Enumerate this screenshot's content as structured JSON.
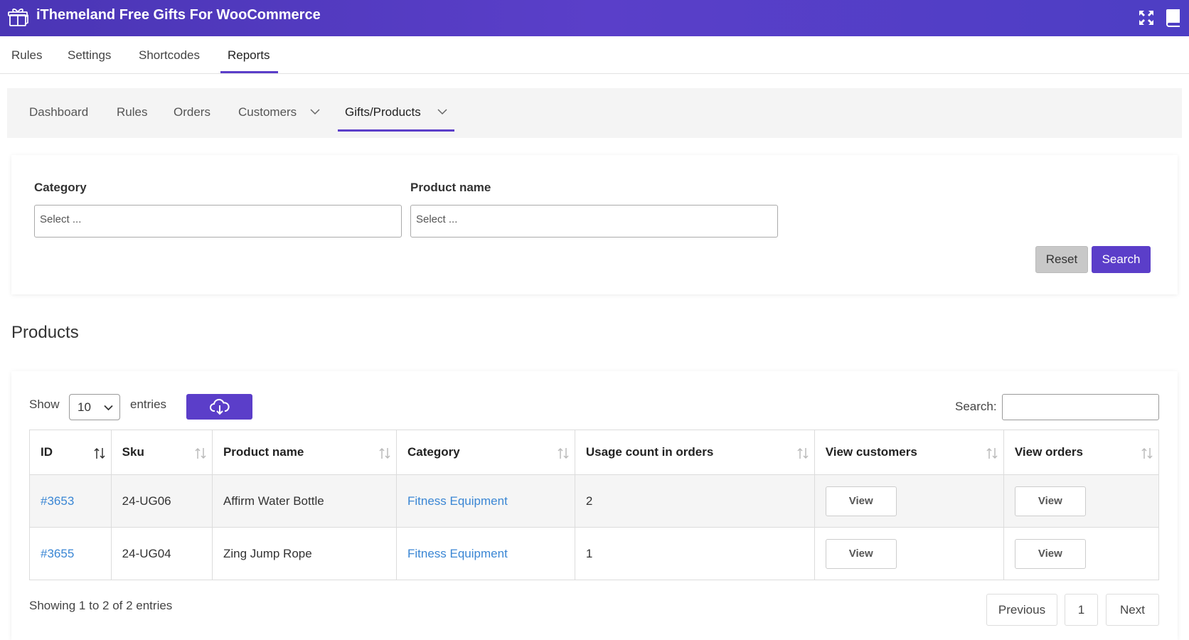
{
  "app": {
    "title": "iThemeland Free Gifts For WooCommerce"
  },
  "main_tabs": [
    "Rules",
    "Settings",
    "Shortcodes",
    "Reports"
  ],
  "sub_tabs": [
    "Dashboard",
    "Rules",
    "Orders",
    "Customers",
    "Gifts/Products"
  ],
  "filters": {
    "category_label": "Category",
    "category_placeholder": "Select ...",
    "product_label": "Product name",
    "product_placeholder": "Select ...",
    "reset_label": "Reset",
    "search_label": "Search"
  },
  "section_title": "Products",
  "table_controls": {
    "show_label": "Show",
    "entries_value": "10",
    "entries_label": "entries",
    "search_label": "Search:"
  },
  "columns": [
    "ID",
    "Sku",
    "Product name",
    "Category",
    "Usage count in orders",
    "View customers",
    "View orders"
  ],
  "rows": [
    {
      "id": "#3653",
      "sku": "24-UG06",
      "name": "Affirm Water Bottle",
      "category": "Fitness Equipment",
      "usage": "2",
      "view_customers": "View",
      "view_orders": "View"
    },
    {
      "id": "#3655",
      "sku": "24-UG04",
      "name": "Zing Jump Rope",
      "category": "Fitness Equipment",
      "usage": "1",
      "view_customers": "View",
      "view_orders": "View"
    }
  ],
  "footer": {
    "showing": "Showing 1 to 2 of 2 entries",
    "previous": "Previous",
    "page": "1",
    "next": "Next"
  },
  "colors": {
    "accent": "#5b3ec9",
    "link": "#3a86d4"
  },
  "icons": [
    "gift-box-icon",
    "fullscreen-icon",
    "book-icon",
    "chevron-down-icon",
    "cloud-download-icon",
    "sort-icon"
  ]
}
